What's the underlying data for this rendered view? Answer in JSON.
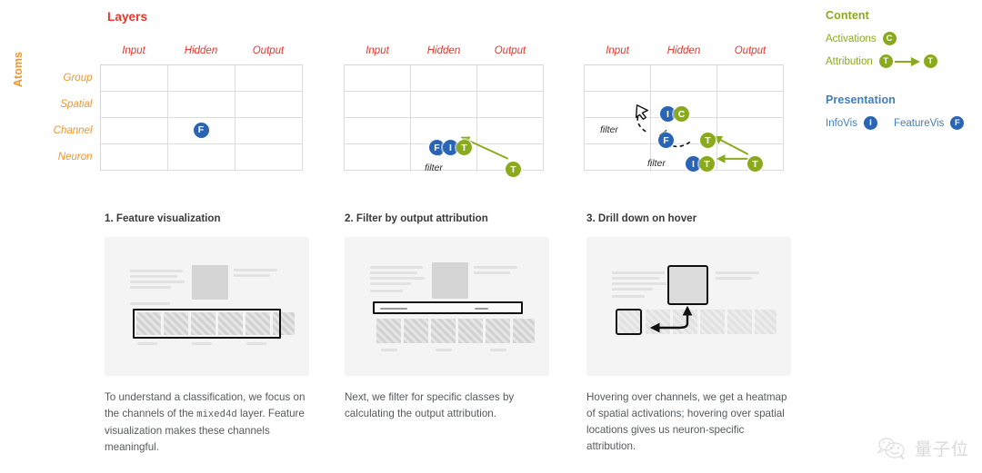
{
  "matrix": {
    "layers_title": "Layers",
    "atoms_title": "Atoms",
    "columns": [
      "Input",
      "Hidden",
      "Output"
    ],
    "rows": [
      "Group",
      "Spatial",
      "Channel",
      "Neuron"
    ],
    "filter_label": "filter",
    "panels": [
      {
        "id": "matrix-1",
        "badges": [
          {
            "row": "Channel",
            "col": "Hidden",
            "items": [
              "F"
            ],
            "colors": [
              "blue"
            ]
          }
        ],
        "arrows": [],
        "filters": []
      },
      {
        "id": "matrix-2",
        "badges": [
          {
            "row": "Channel",
            "col": "Hidden",
            "items": [
              "F",
              "I",
              "T"
            ],
            "colors": [
              "blue",
              "blue",
              "green"
            ]
          },
          {
            "row": "Channel",
            "col": "Output",
            "items": [
              "T"
            ],
            "colors": [
              "green"
            ]
          }
        ],
        "filters": [
          "filter"
        ]
      },
      {
        "id": "matrix-3",
        "badges": [
          {
            "row": "Spatial",
            "col": "Hidden",
            "items": [
              "I",
              "C"
            ],
            "colors": [
              "blue",
              "green"
            ]
          },
          {
            "row": "Channel",
            "col": "Hidden",
            "items": [
              "F"
            ],
            "colors": [
              "blue"
            ]
          },
          {
            "row": "Channel",
            "col": "Output",
            "items": [
              "T"
            ],
            "colors": [
              "green"
            ]
          },
          {
            "row": "Neuron",
            "col": "Hidden",
            "items": [
              "I",
              "T"
            ],
            "colors": [
              "blue",
              "green"
            ]
          },
          {
            "row": "Neuron",
            "col": "Output",
            "items": [
              "T"
            ],
            "colors": [
              "green"
            ]
          }
        ],
        "filters": [
          "filter",
          "filter"
        ]
      }
    ]
  },
  "legend": {
    "content_heading": "Content",
    "activations_label": "Activations",
    "activations_badge": "C",
    "attribution_label": "Attribution",
    "attribution_badge_from": "T",
    "attribution_badge_to": "T",
    "presentation_heading": "Presentation",
    "infovis_label": "InfoVis",
    "infovis_badge": "I",
    "featurevis_label": "FeatureVis",
    "featurevis_badge": "F",
    "colors": {
      "content": "#8aaa1e",
      "presentation": "#3f7fbf",
      "blue_badge": "#2a64b4",
      "green_badge": "#8aaa1e",
      "layers": "#e8352a",
      "atoms": "#f0962a"
    }
  },
  "steps": [
    {
      "title": "1. Feature visualization",
      "caption_pre": "To understand a classification, we focus on the channels of the ",
      "caption_code": "mixed4d",
      "caption_post": " layer. Feature visualization makes these channels meaningful."
    },
    {
      "title": "2. Filter by output attribution",
      "caption_pre": "Next, we filter for specific classes by calculating the output attribution.",
      "caption_code": "",
      "caption_post": ""
    },
    {
      "title": "3. Drill down on hover",
      "caption_pre": "Hovering over channels, we get a heatmap of spatial activations; hovering over spatial locations gives us neuron-specific attribution.",
      "caption_code": "",
      "caption_post": ""
    }
  ],
  "watermark": {
    "text": "量子位",
    "icon": "smiley-face-logo"
  }
}
